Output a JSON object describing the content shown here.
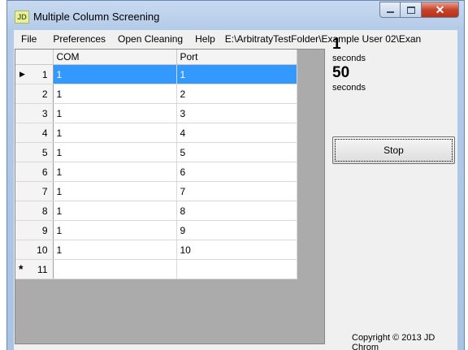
{
  "window": {
    "icon_text": "JD",
    "title": "Multiple Column Screening",
    "close_glyph": "✕"
  },
  "menu": {
    "items": [
      "File",
      "Preferences",
      "Open Cleaning",
      "Help"
    ],
    "path": "E:\\ArbitratyTestFolder\\Example User 02\\Exan"
  },
  "grid": {
    "columns": [
      "COM",
      "Port"
    ],
    "rows": [
      {
        "num": "1",
        "com": "1",
        "port": "1"
      },
      {
        "num": "2",
        "com": "1",
        "port": "2"
      },
      {
        "num": "3",
        "com": "1",
        "port": "3"
      },
      {
        "num": "4",
        "com": "1",
        "port": "4"
      },
      {
        "num": "5",
        "com": "1",
        "port": "5"
      },
      {
        "num": "6",
        "com": "1",
        "port": "6"
      },
      {
        "num": "7",
        "com": "1",
        "port": "7"
      },
      {
        "num": "8",
        "com": "1",
        "port": "8"
      },
      {
        "num": "9",
        "com": "1",
        "port": "9"
      },
      {
        "num": "10",
        "com": "1",
        "port": "10"
      }
    ],
    "new_row_num": "11",
    "current_marker": "▶",
    "new_marker": "*",
    "selected_color": "#3399ff"
  },
  "timers": {
    "value1": "1",
    "unit1": "seconds",
    "value2": "50",
    "unit2": "seconds"
  },
  "actions": {
    "stop_label": "Stop"
  },
  "footer": {
    "copyright": "Copyright © 2013 JD Chrom"
  }
}
